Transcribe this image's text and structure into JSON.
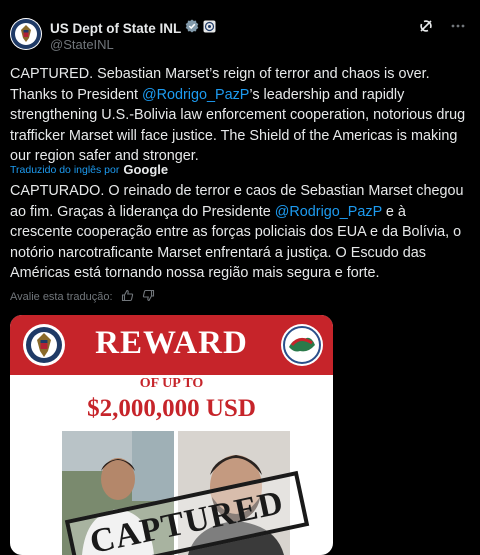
{
  "account": {
    "display_name": "US Dept of State INL",
    "handle": "@StateINL"
  },
  "tweet": {
    "original_1": "CAPTURED. Sebastian Marset’s reign of terror and chaos is over. Thanks to President ",
    "original_mention": "@Rodrigo_PazP",
    "original_2": "’s leadership and rapidly strengthening U.S.-Bolivia law enforcement cooperation, notorious drug trafficker Marset will face justice. The Shield of the Americas is making our region safer and stronger.",
    "translated_by_label": "Traduzido do inglês por",
    "translated_by_brand": "Google",
    "translation_1": "CAPTURADO. O reinado de terror e caos de Sebastian Marset chegou ao fim. Graças à liderança do Presidente ",
    "translation_mention": "@Rodrigo_PazP",
    "translation_2": " e à crescente cooperação entre as forças policiais dos EUA e da Bolívia, o notório narcotraficante Marset enfrentará a justiça. O Escudo das Américas está tornando nossa região mais segura e forte.",
    "rate_translation_label": "Avalie esta tradução:"
  },
  "poster": {
    "title": "REWARD",
    "of_up_to": "OF UP TO",
    "amount": "$2,000,000 USD",
    "stamp": "CAPTURED"
  },
  "icons": {
    "verified": "verified-badge-icon",
    "affiliate": "affiliate-badge-icon",
    "grok": "grok-icon",
    "more": "more-icon",
    "thumbs_up": "thumbs-up-icon",
    "thumbs_down": "thumbs-down-icon"
  },
  "colors": {
    "background": "#000000",
    "text": "#e7e9ea",
    "secondary": "#71767b",
    "link": "#1d9bf0",
    "verified": "#829aab",
    "poster_red": "#c6242a"
  }
}
